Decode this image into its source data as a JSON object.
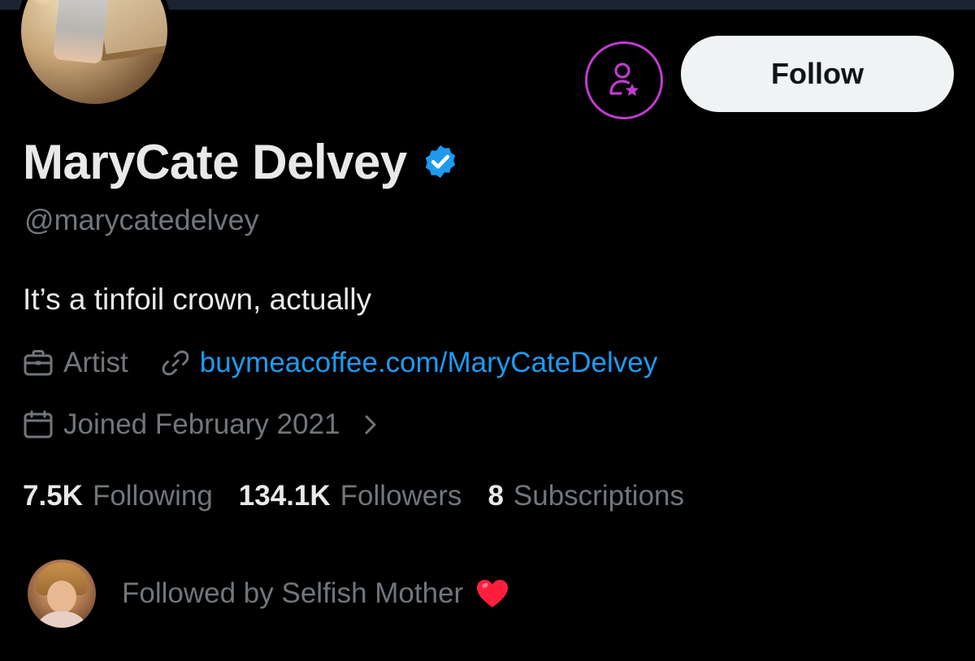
{
  "profile": {
    "display_name": "MaryCate Delvey",
    "handle": "@marycatedelvey",
    "bio": "It’s a tinfoil crown, actually",
    "category": "Artist",
    "website": "buymeacoffee.com/MaryCateDelvey",
    "joined": "Joined February 2021"
  },
  "actions": {
    "follow_label": "Follow",
    "subscribe_icon": "person-star-icon"
  },
  "stats": {
    "following_count": "7.5K",
    "following_label": "Following",
    "followers_count": "134.1K",
    "followers_label": "Followers",
    "subscriptions_count": "8",
    "subscriptions_label": "Subscriptions"
  },
  "followed_by": {
    "text": "Followed by Selfish Mother",
    "emoji": "heart-icon"
  },
  "icons": {
    "verified": "verified-badge-icon",
    "category": "briefcase-icon",
    "website": "link-icon",
    "joined": "calendar-icon",
    "joined_more": "chevron-right-icon"
  },
  "colors": {
    "background": "#000000",
    "text_primary": "#e7e9ea",
    "text_secondary": "#71767b",
    "link": "#1d9bf0",
    "verified": "#1d9bf0",
    "subscribe_accent": "#c13bd1",
    "follow_button_bg": "#eff3f4",
    "heart": "#ff1f3d"
  }
}
